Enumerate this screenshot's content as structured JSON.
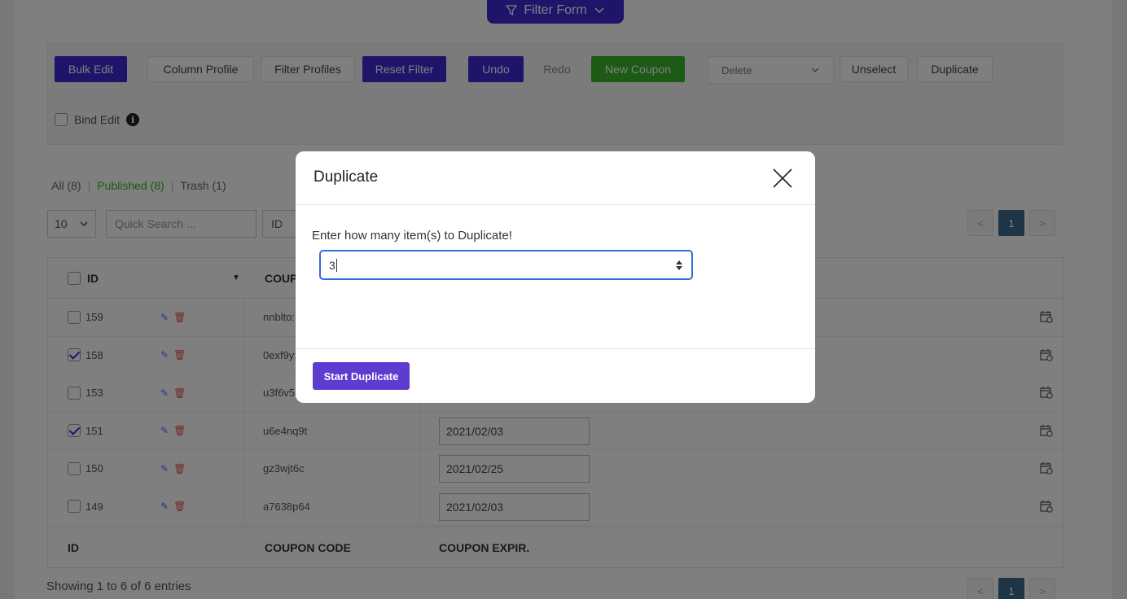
{
  "filter_form": {
    "label": "Filter Form",
    "icon": "filter-icon"
  },
  "toolbar": {
    "bulk_edit": "Bulk Edit",
    "column_profile": "Column Profile",
    "filter_profiles": "Filter Profiles",
    "reset_filter": "Reset Filter",
    "undo": "Undo",
    "redo": "Redo",
    "new_coupon": "New Coupon",
    "action_select": "Delete",
    "unselect": "Unselect",
    "duplicate": "Duplicate",
    "bind_edit": "Bind Edit"
  },
  "status_links": {
    "all": "All (8)",
    "published": "Published (8)",
    "trash": "Trash (1)",
    "separator": "|"
  },
  "controls": {
    "per_page": "10",
    "search_placeholder": "Quick Search ...",
    "id_select": "ID"
  },
  "pagination": {
    "prev": "<",
    "current": "1",
    "next": ">"
  },
  "table": {
    "headers": {
      "id": "ID",
      "coupon_code": "COUPON CODE",
      "coupon_expiry": "COUPON EXPIR."
    },
    "header_coupon_partial": "COUP",
    "rows": [
      {
        "id": "159",
        "code": "nnblto:",
        "checked": false,
        "expiry": ""
      },
      {
        "id": "158",
        "code": "0exf9y:",
        "checked": true,
        "expiry": ""
      },
      {
        "id": "153",
        "code": "u3f6v5",
        "checked": false,
        "expiry": ""
      },
      {
        "id": "151",
        "code": "u6e4nq9t",
        "checked": true,
        "expiry": "2021/02/03"
      },
      {
        "id": "150",
        "code": "gz3wjt6c",
        "checked": false,
        "expiry": "2021/02/25"
      },
      {
        "id": "149",
        "code": "a7638p64",
        "checked": false,
        "expiry": "2021/02/03"
      }
    ]
  },
  "footer": {
    "showing": "Showing 1 to 6 of 6 entries"
  },
  "modal": {
    "title": "Duplicate",
    "label": "Enter how many item(s) to Duplicate!",
    "value": "3",
    "submit": "Start Duplicate"
  },
  "colors": {
    "primary": "#3d2bd6",
    "success": "#38b52a",
    "modal_button": "#5d3ccf",
    "focus": "#2f6fd6"
  }
}
